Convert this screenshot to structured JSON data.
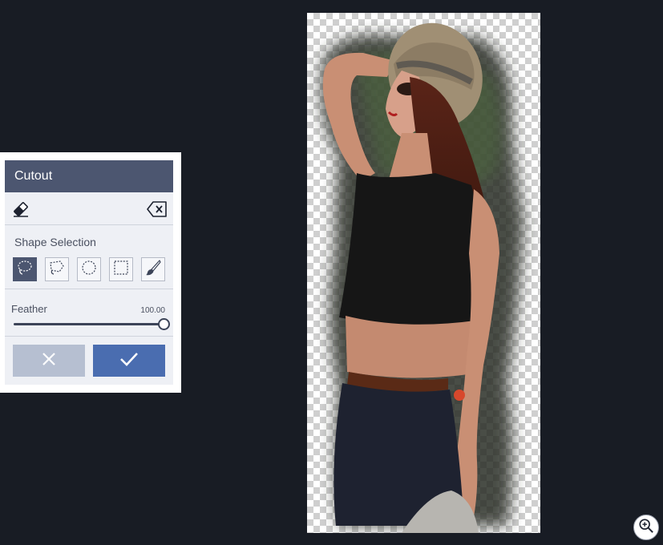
{
  "panel": {
    "title": "Cutout",
    "tools": {
      "eraser_icon": "eraser-icon",
      "clear_icon": "backspace-icon"
    },
    "shape_selection": {
      "title": "Shape Selection",
      "shapes": [
        {
          "name": "lasso",
          "icon": "lasso-icon",
          "active": true
        },
        {
          "name": "polygon-lasso",
          "icon": "polygon-lasso-icon",
          "active": false
        },
        {
          "name": "ellipse",
          "icon": "ellipse-select-icon",
          "active": false
        },
        {
          "name": "rectangle",
          "icon": "rectangle-select-icon",
          "active": false
        },
        {
          "name": "brush",
          "icon": "brush-icon",
          "active": false
        }
      ]
    },
    "feather": {
      "label": "Feather",
      "value_text": "100.00",
      "value_fraction": 1.0
    },
    "actions": {
      "cancel_icon": "close-icon",
      "apply_icon": "check-icon"
    }
  },
  "colors": {
    "background": "#181c24",
    "panel_header": "#4c5670",
    "cancel_button": "#b6bfd1",
    "apply_button": "#4a6db0"
  },
  "zoom": {
    "icon": "zoom-in-icon"
  }
}
